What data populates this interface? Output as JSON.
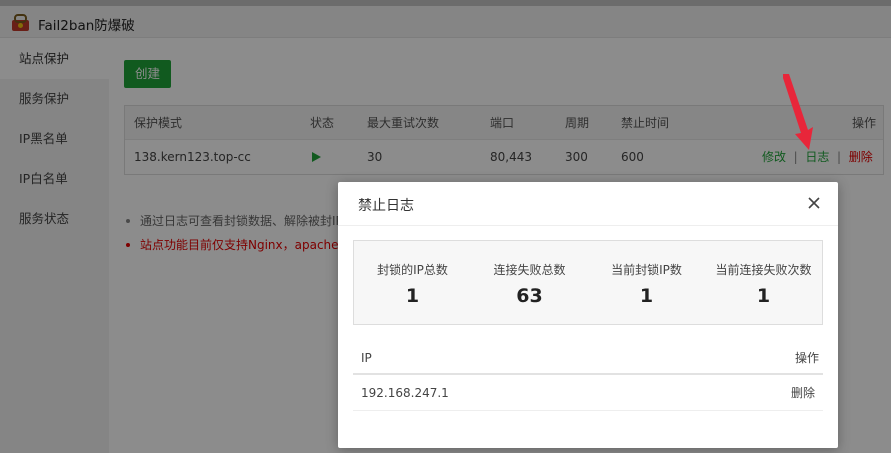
{
  "app": {
    "title": "Fail2ban防爆破"
  },
  "sidebar": {
    "items": [
      {
        "label": "站点保护"
      },
      {
        "label": "服务保护"
      },
      {
        "label": "IP黑名单"
      },
      {
        "label": "IP白名单"
      },
      {
        "label": "服务状态"
      }
    ]
  },
  "main": {
    "create_label": "创建",
    "table": {
      "headers": {
        "mode": "保护模式",
        "status": "状态",
        "max_retry": "最大重试次数",
        "port": "端口",
        "period": "周期",
        "ban_time": "禁止时间",
        "action": "操作"
      },
      "rows": [
        {
          "mode": "138.kern123.top-cc",
          "status": "running",
          "max_retry": "30",
          "port": "80,443",
          "period": "300",
          "ban_time": "600",
          "edit": "修改",
          "log": "日志",
          "delete": "删除"
        }
      ]
    },
    "notes": [
      "通过日志可查看封锁数据、解除被封IP",
      "站点功能目前仅支持Nginx，apache"
    ]
  },
  "modal": {
    "title": "禁止日志",
    "stats": [
      {
        "label": "封锁的IP总数",
        "value": "1"
      },
      {
        "label": "连接失败总数",
        "value": "63"
      },
      {
        "label": "当前封锁IP数",
        "value": "1"
      },
      {
        "label": "当前连接失败次数",
        "value": "1"
      }
    ],
    "log_table": {
      "headers": {
        "ip": "IP",
        "action": "操作"
      },
      "rows": [
        {
          "ip": "192.168.247.1",
          "delete": "删除"
        }
      ]
    }
  },
  "colors": {
    "accent": "#20a53a",
    "danger": "#e60000",
    "arrow": "#e8263a"
  }
}
